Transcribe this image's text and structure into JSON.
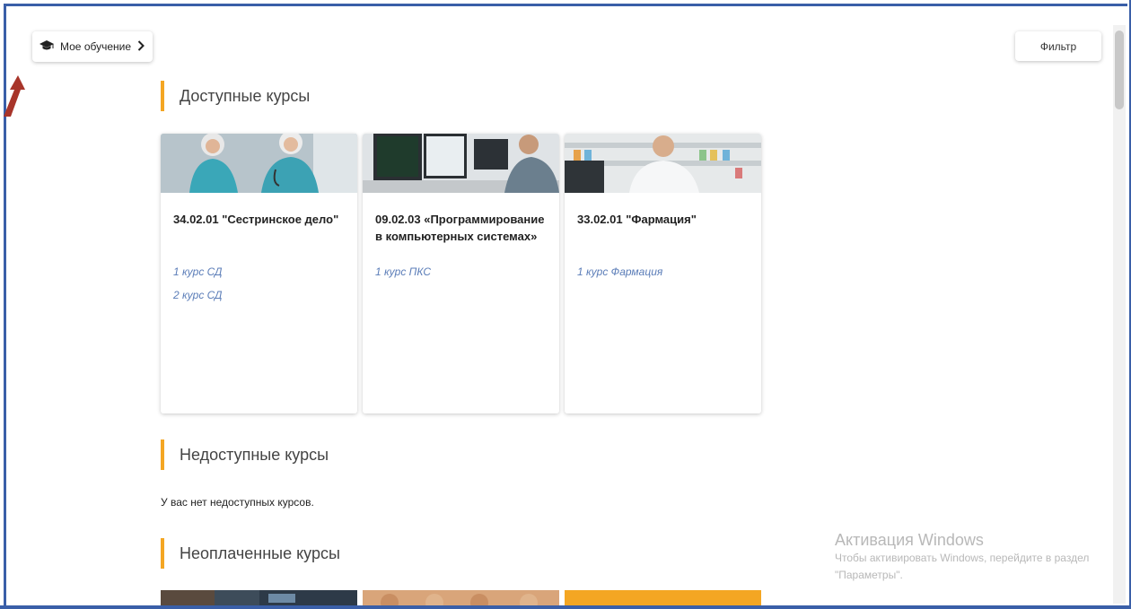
{
  "header": {
    "my_learning_label": "Мое обучение",
    "filter_label": "Фильтр"
  },
  "sections": {
    "available_title": "Доступные курсы",
    "unavailable_title": "Недоступные курсы",
    "unavailable_empty": "У вас нет недоступных курсов.",
    "unpaid_title": "Неоплаченные курсы"
  },
  "available_courses": [
    {
      "title": "34.02.01 \"Сестринское дело\"",
      "links": [
        "1 курс СД",
        "2 курс СД"
      ]
    },
    {
      "title": "09.02.03 «Программирование в компьютерных системах»",
      "links": [
        "1 курс ПКС"
      ]
    },
    {
      "title": "33.02.01 \"Фармация\"",
      "links": [
        "1 курс Фармация"
      ]
    }
  ],
  "windows_activation": {
    "title": "Активация Windows",
    "text": "Чтобы активировать Windows, перейдите в раздел \"Параметры\"."
  },
  "colors": {
    "accent": "#f4a623",
    "link": "#5b7db8",
    "frame": "#3a5fa8"
  },
  "icons": [
    "graduation-cap-icon",
    "chevron-right-icon"
  ]
}
